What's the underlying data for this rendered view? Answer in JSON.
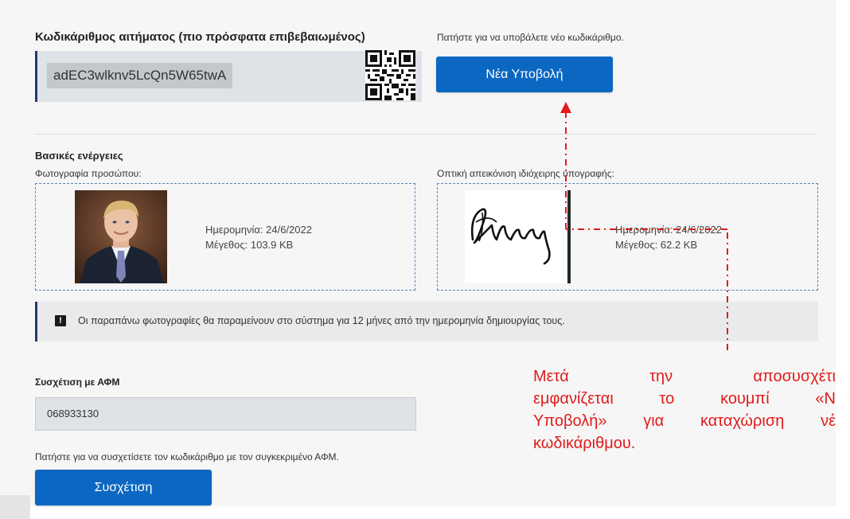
{
  "request_code": {
    "label": "Κωδικάριθμος αιτήματος (πιο πρόσφατα επιβεβαιωμένος)",
    "value": "adEC3wlknv5LcQn5W65twA"
  },
  "new_submission": {
    "hint": "Πατήστε για να υποβάλετε νέο κωδικάριθμο.",
    "button_label": "Νέα Υποβολή"
  },
  "basic_actions": {
    "title": "Βασικές ενέργειες",
    "photo": {
      "label": "Φωτογραφία προσώπου:",
      "date": "Ημερομηνία: 24/6/2022",
      "size": "Μέγεθος: 103.9 KB"
    },
    "signature": {
      "label": "Οπτική απεικόνιση ιδιόχειρης υπογραφής:",
      "date": "Ημερομηνία: 24/6/2022",
      "size": "Μέγεθος: 62.2 KB"
    }
  },
  "notice": {
    "icon": "exclamation-icon",
    "text": "Οι παραπάνω φωτογραφίες θα παραμείνουν στο σύστημα για 12 μήνες από την ημερομηνία δημιουργίας τους."
  },
  "afm": {
    "label": "Συσχέτιση με ΑΦΜ",
    "value": "068933130",
    "hint": "Πατήστε για να συσχετίσετε τον κωδικάριθμο με τον συγκεκριμένο ΑΦΜ.",
    "button_label": "Συσχέτιση"
  },
  "annotation": {
    "line1": [
      "Μετά",
      "την",
      "αποσυσχέτι"
    ],
    "line2": [
      "εμφανίζεται",
      "το",
      "κουμπί",
      "«Ν"
    ],
    "line3": [
      "Υποβολή»",
      "για",
      "καταχώριση",
      "νέ"
    ],
    "line4": "κωδικάριθμου."
  },
  "colors": {
    "primary_button": "#0b67c2",
    "accent_border": "#1f3b6e",
    "annotation_red": "#e01b1b"
  }
}
